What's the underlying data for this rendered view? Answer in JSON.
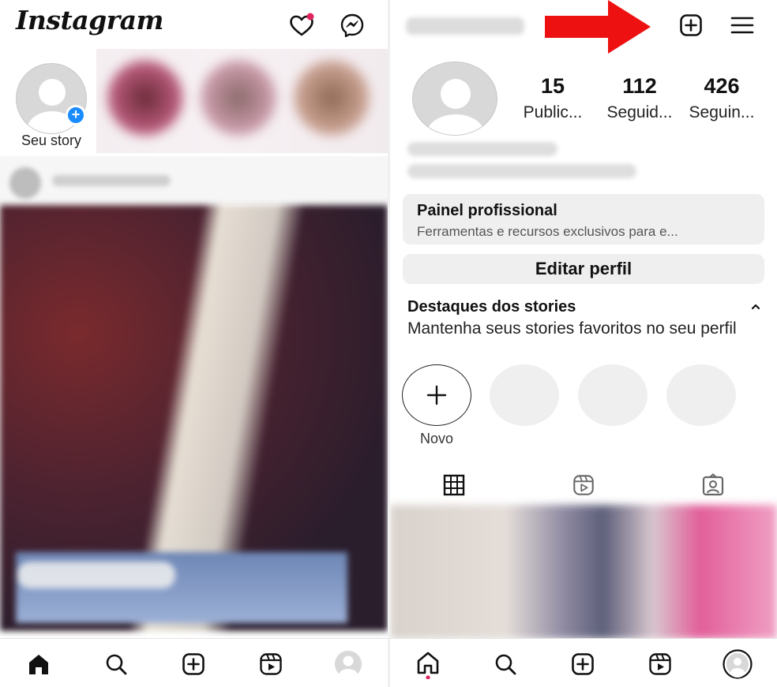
{
  "left_screen": {
    "app_title": "Instagram",
    "header_icons": [
      "heart-icon",
      "messenger-icon"
    ],
    "stories": {
      "own_story_label": "Seu story",
      "add_badge_symbol": "+"
    },
    "bottom_nav": [
      "home-icon",
      "search-icon",
      "create-post-icon",
      "reels-icon",
      "profile-avatar-icon"
    ]
  },
  "right_screen": {
    "header_icons": [
      "create-post-icon",
      "menu-icon"
    ],
    "annotation_arrow_color": "#ee1111",
    "stats": [
      {
        "value": "15",
        "label": "Public..."
      },
      {
        "value": "112",
        "label": "Seguid..."
      },
      {
        "value": "426",
        "label": "Seguin..."
      }
    ],
    "professional_panel": {
      "title": "Painel profissional",
      "subtitle": "Ferramentas e recursos exclusivos para e..."
    },
    "edit_profile_label": "Editar perfil",
    "highlights": {
      "title": "Destaques dos stories",
      "description": "Mantenha seus stories favoritos no seu perfil",
      "new_symbol": "+",
      "new_label": "Novo"
    },
    "profile_tabs": [
      "grid-icon",
      "reels-tab-icon",
      "tagged-icon"
    ],
    "bottom_nav": [
      "home-icon",
      "search-icon",
      "create-post-icon",
      "reels-icon",
      "profile-avatar-icon"
    ]
  },
  "colors": {
    "accent_blue": "#1a8cff",
    "notification_red": "#e0245e",
    "panel_gray": "#efefef"
  }
}
